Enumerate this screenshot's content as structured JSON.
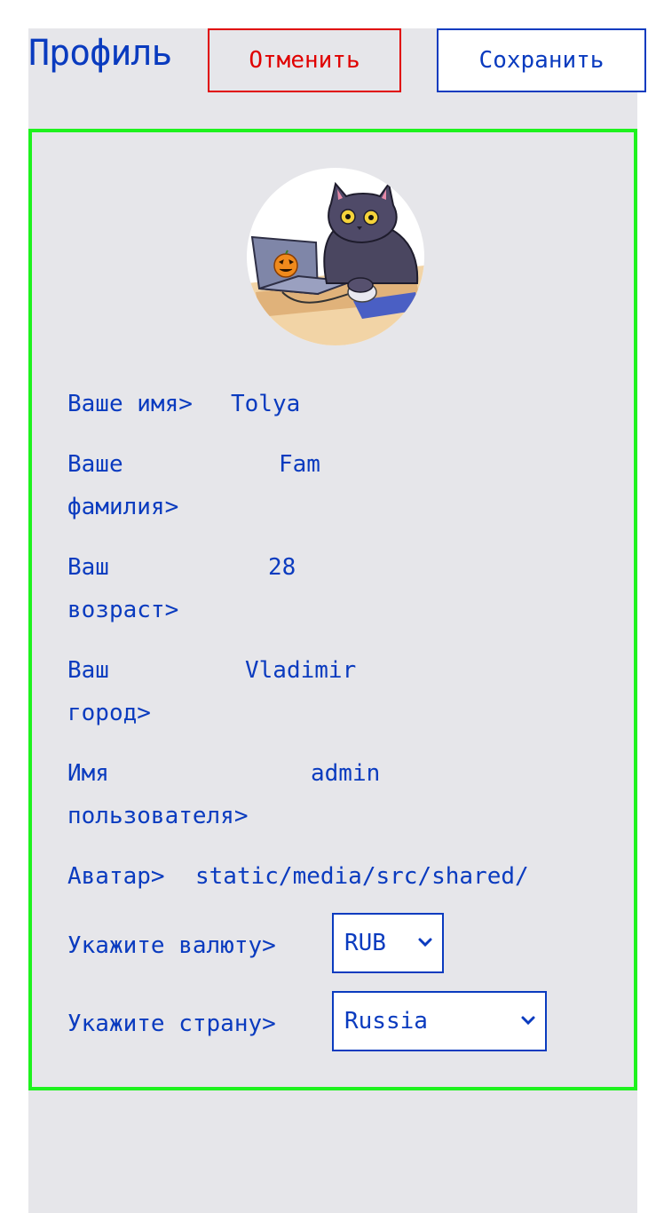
{
  "header": {
    "title": "Профиль",
    "cancel_label": "Отменить",
    "save_label": "Сохранить"
  },
  "profile": {
    "name_label": "Ваше имя>",
    "name_value": "Tolya",
    "surname_label_line1": "Ваше",
    "surname_label_line2": "фамилия>",
    "surname_value": "Fam",
    "age_label_line1": "Ваш",
    "age_label_line2": "возраст>",
    "age_value": "28",
    "city_label_line1": "Ваш",
    "city_label_line2": "город>",
    "city_value": "Vladimir",
    "username_label_line1": "Имя",
    "username_label_line2": "пользователя>",
    "username_value": "admin",
    "avatar_label": "Аватар>",
    "avatar_value": "static/media/src/shared/",
    "currency_label": "Укажите валюту>",
    "currency_value": "RUB",
    "country_label": "Укажите страну>",
    "country_value": "Russia"
  },
  "colors": {
    "text": "#0a3bbf",
    "cancel": "#e00000",
    "card_border": "#1ef21e",
    "panel_bg": "#e6e6ea"
  },
  "icons": {
    "avatar": "cat-at-laptop-avatar",
    "select": "chevron-down-icon"
  }
}
